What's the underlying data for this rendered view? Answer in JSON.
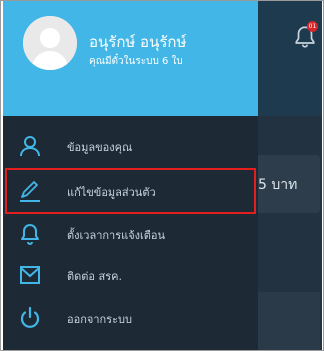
{
  "app": {
    "card_text": "5 บาท",
    "notification_badge": "01",
    "bell_icon": "bell-icon"
  },
  "drawer": {
    "user": {
      "name": "อนุรักษ์ อนุรักษ์",
      "subtitle": "คุณมีตั๋วในระบบ 6 ใบ",
      "avatar_icon": "avatar-placeholder-icon"
    },
    "menu": [
      {
        "label": "ข้อมูลของคุณ",
        "icon": "user-icon"
      },
      {
        "label": "แก้ไขข้อมูลส่วนตัว",
        "icon": "pencil-icon",
        "highlighted": true
      },
      {
        "label": "ตั้งเวลาการแจ้งเตือน",
        "icon": "bell-icon"
      },
      {
        "label": "ติดต่อ สรค.",
        "icon": "mail-icon"
      },
      {
        "label": "ออกจากระบบ",
        "icon": "power-icon"
      }
    ]
  },
  "colors": {
    "drawer_header": "#41b6e7",
    "drawer_body": "#1d2a36",
    "icon_accent": "#41b6e7",
    "highlight_border": "#e41d1d",
    "menu_text": "#c9d4dd"
  }
}
